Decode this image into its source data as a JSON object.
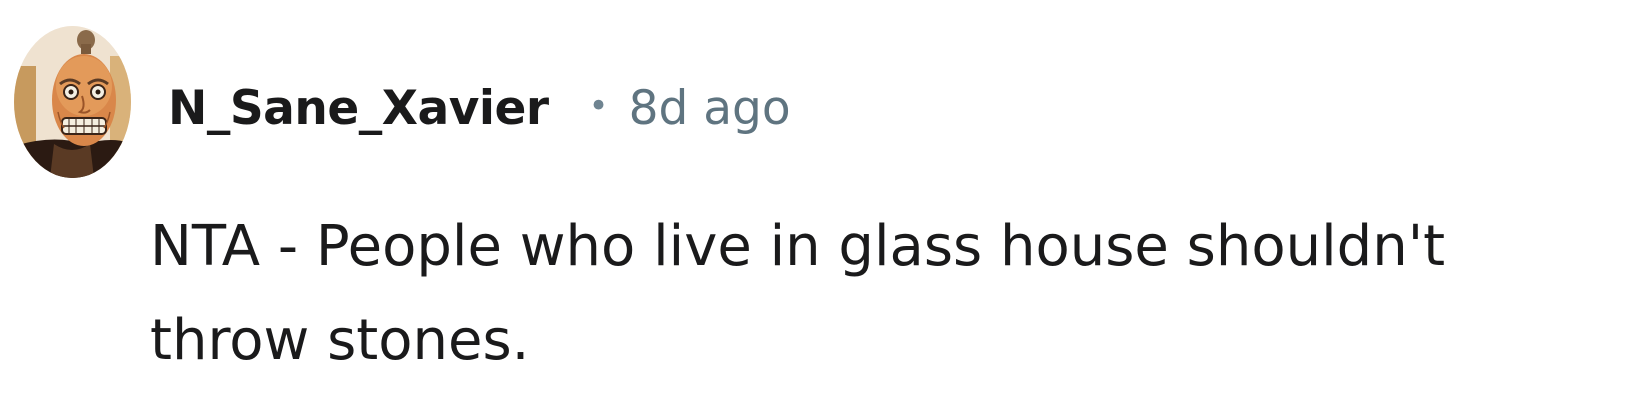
{
  "comment": {
    "avatar_icon": "cartoon-old-man-avatar-icon",
    "username": "N_Sane_Xavier",
    "separator": "•",
    "timestamp": "8d ago",
    "body": "NTA - People who live in glass house shouldn't throw stones."
  },
  "colors": {
    "username": "#1a1a1b",
    "meta": "#5f7480",
    "body": "#1a1a1b",
    "background": "#ffffff"
  }
}
